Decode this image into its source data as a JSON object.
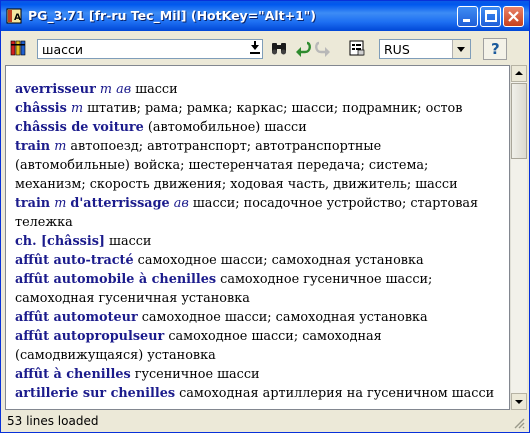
{
  "window": {
    "title": "PG_3.71 [fr-ru Tec_Mil] (HotKey=\"Alt+1\")"
  },
  "toolbar": {
    "search_value": "шасси",
    "language_value": "RUS",
    "help_label": "?"
  },
  "entries": [
    {
      "term": "averrisseur",
      "gram": "m ав",
      "text": " шасси"
    },
    {
      "term": "châssis",
      "gram": "m",
      "text": " штатив; рама; рамка; каркас; шасси; подрамник; остов"
    },
    {
      "term": "châssis de voiture",
      "gram": "",
      "text": " (автомобильное) шасси"
    },
    {
      "term": "train",
      "gram": "m",
      "text": " автопоезд; автотранспорт; автотранспортные (автомобильные) войска; шестеренчатая передача; система; механизм; скорость движения; ходовая часть, движитель; шасси"
    },
    {
      "term": "train",
      "gram": "m",
      "term2": "d'atterrissage",
      "gram2": "ав",
      "text": " шасси; посадочное устройство; стартовая тележка"
    },
    {
      "term": "ch. [châssis]",
      "gram": "",
      "text": " шасси"
    },
    {
      "term": "affût auto-tracté",
      "gram": "",
      "text": " самоходное шасси; самоходная установка"
    },
    {
      "term": "affût automobile à chenilles",
      "gram": "",
      "text": " самоходное гусеничное шасси; самоходная гусеничная установка"
    },
    {
      "term": "affût automoteur",
      "gram": "",
      "text": " самоходное шасси; самоходная установка"
    },
    {
      "term": "affût autopropulseur",
      "gram": "",
      "text": " самоходное шасси; самоходная (самодвижущаяся) установка"
    },
    {
      "term": "affût à chenilles",
      "gram": "",
      "text": " гусеничное шасси"
    },
    {
      "term": "artillerie sur chenilles",
      "gram": "",
      "text": " самоходная артиллерия на гусеничном шасси"
    }
  ],
  "status": {
    "text": "53 lines loaded"
  },
  "icons": {
    "app": "dictionary-book-icon",
    "books": "books-icon",
    "search_dropdown": "dropdown-arrow-icon",
    "find": "binoculars-icon",
    "back": "back-arrow-icon",
    "forward": "forward-arrow-icon",
    "settings": "properties-icon"
  }
}
